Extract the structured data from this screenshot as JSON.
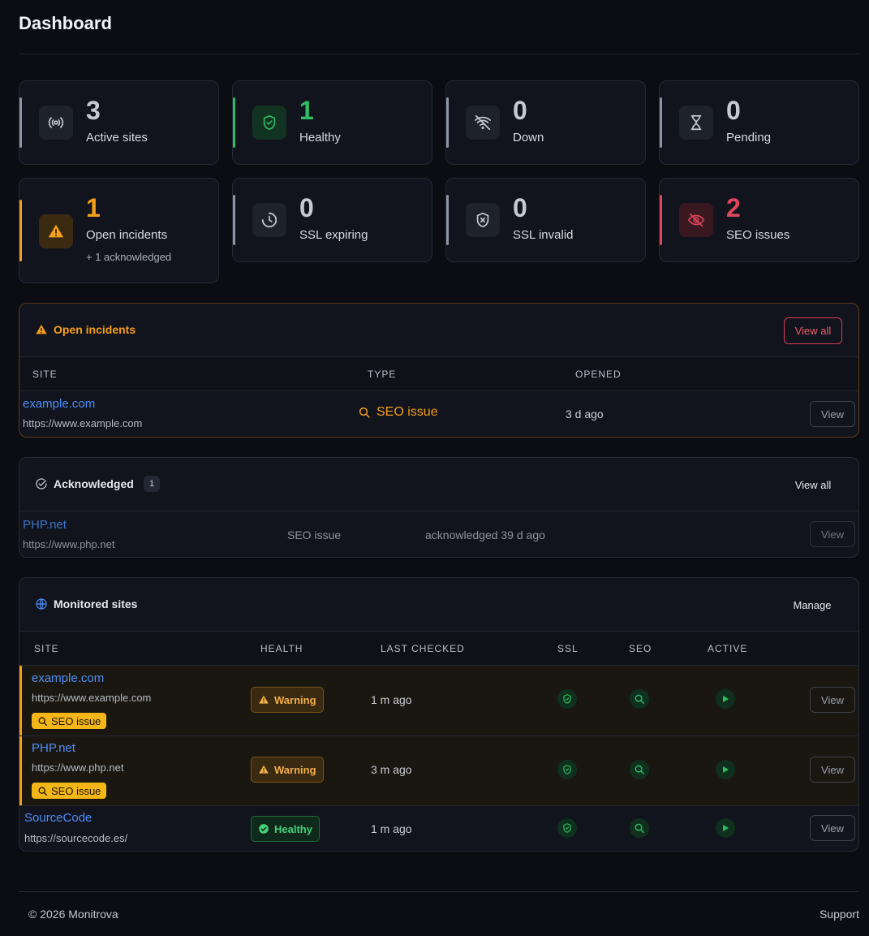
{
  "page": {
    "title": "Dashboard"
  },
  "stats": [
    {
      "value": "3",
      "label": "Active sites",
      "icon": "broadcast-icon",
      "color": "#8c96a8"
    },
    {
      "value": "1",
      "label": "Healthy",
      "icon": "shield-check-icon",
      "color": "#2ebd63"
    },
    {
      "value": "0",
      "label": "Down",
      "icon": "wifi-off-icon",
      "color": "#8c96a8"
    },
    {
      "value": "0",
      "label": "Pending",
      "icon": "hourglass-icon",
      "color": "#8c96a8"
    },
    {
      "value": "1",
      "label": "Open incidents",
      "sub": "+ 1 acknowledged",
      "icon": "warning-icon",
      "color": "#f59e1b"
    },
    {
      "value": "0",
      "label": "SSL expiring",
      "icon": "clock-icon",
      "color": "#8c96a8"
    },
    {
      "value": "0",
      "label": "SSL invalid",
      "icon": "shield-x-icon",
      "color": "#8c96a8"
    },
    {
      "value": "2",
      "label": "SEO issues",
      "icon": "eye-off-icon",
      "color": "#e0475c"
    }
  ],
  "incidents": {
    "title": "Open incidents",
    "view_all": "View all",
    "columns": [
      "SITE",
      "TYPE",
      "OPENED"
    ],
    "rows": [
      {
        "site": "example.com",
        "url": "https://www.example.com",
        "type": "SEO issue",
        "opened": "3 d ago",
        "action": "View"
      }
    ]
  },
  "acknowledged": {
    "title": "Acknowledged",
    "count": "1",
    "view_all": "View all",
    "rows": [
      {
        "site": "PHP.net",
        "url": "https://www.php.net",
        "type": "SEO issue",
        "when": "acknowledged 39 d ago",
        "action": "View"
      }
    ]
  },
  "monitored": {
    "title": "Monitored sites",
    "manage": "Manage",
    "columns": [
      "SITE",
      "HEALTH",
      "LAST CHECKED",
      "SSL",
      "SEO",
      "ACTIVE"
    ],
    "rows": [
      {
        "site": "example.com",
        "url": "https://www.example.com",
        "chip": "SEO issue",
        "health": "Warning",
        "checked": "1 m ago",
        "action": "View"
      },
      {
        "site": "PHP.net",
        "url": "https://www.php.net",
        "chip": "SEO issue",
        "health": "Warning",
        "checked": "3 m ago",
        "action": "View"
      },
      {
        "site": "SourceCode",
        "url": "https://sourcecode.es/",
        "health": "Healthy",
        "checked": "1 m ago",
        "action": "View"
      }
    ]
  },
  "footer": {
    "copyright": "© 2026  Monitrova",
    "support": "Support"
  }
}
